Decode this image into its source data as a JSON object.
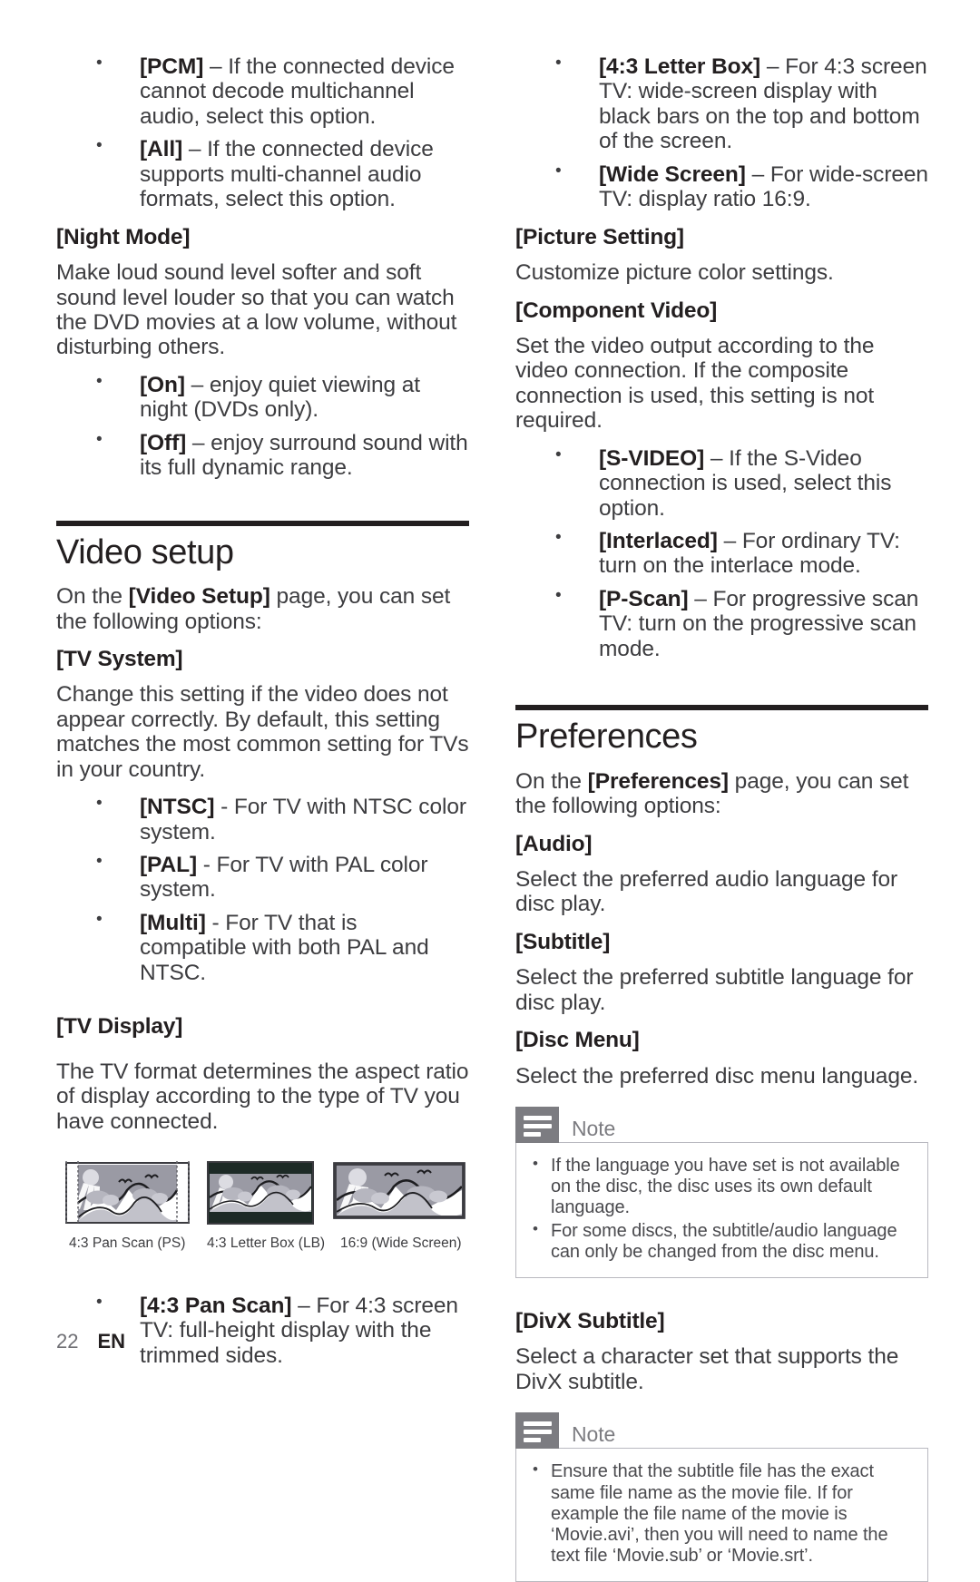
{
  "page": {
    "number": "22",
    "language": "EN"
  },
  "left_column": {
    "audio_bullets": [
      {
        "term": "[PCM]",
        "dash": " – ",
        "text": "If the connected device cannot decode multichannel audio, select this option."
      },
      {
        "term": "[All]",
        "dash": " – ",
        "text": "If the connected device supports multi-channel audio formats, select this option."
      }
    ],
    "night_mode": {
      "heading": "[Night Mode]",
      "paragraph": "Make loud sound level softer and soft sound level louder so that you can watch the DVD movies at a low volume, without disturbing others.",
      "bullets": [
        {
          "term": "[On]",
          "dash": " – ",
          "text": "enjoy quiet viewing at night (DVDs only)."
        },
        {
          "term": "[Off]",
          "dash": " – ",
          "text": "enjoy surround sound with its full dynamic range."
        }
      ]
    },
    "video_setup": {
      "title": "Video setup",
      "intro_pre": "On the ",
      "intro_bold": "[Video Setup]",
      "intro_post": " page, you can set the following options:"
    },
    "tv_system": {
      "heading": "[TV System]",
      "paragraph": "Change this setting if the video does not appear correctly. By default, this setting matches the most common setting for TVs in your country.",
      "bullets": [
        {
          "term": "[NTSC]",
          "dash": " - ",
          "text": "For TV with NTSC color system."
        },
        {
          "term": "[PAL]",
          "dash": " - ",
          "text": "For TV with PAL color system."
        },
        {
          "term": "[Multi]",
          "dash": " - ",
          "text": "For TV that is compatible with both PAL and NTSC."
        }
      ]
    },
    "tv_display": {
      "heading": "[TV Display]",
      "paragraph": "The TV format determines the aspect ratio of display according to the type of TV you have connected.",
      "figure_captions": [
        "4:3 Pan Scan (PS)",
        "4:3 Letter Box (LB)",
        "16:9 (Wide Screen)"
      ],
      "bullets": [
        {
          "term": "[4:3 Pan Scan]",
          "dash": " – ",
          "text": "For 4:3 screen TV: full-height display with the trimmed sides."
        }
      ]
    }
  },
  "right_column": {
    "tv_display_bullets": [
      {
        "term": "[4:3 Letter Box]",
        "dash": " – ",
        "text": "For 4:3 screen TV: wide-screen display with black bars on the top and bottom of the screen."
      },
      {
        "term": "[Wide Screen]",
        "dash": " – ",
        "text": "For wide-screen TV: display ratio 16:9."
      }
    ],
    "picture_setting": {
      "heading": "[Picture Setting]",
      "paragraph": "Customize picture color settings."
    },
    "component_video": {
      "heading": "[Component Video]",
      "paragraph": "Set the video output according to the video connection. If the composite connection is used, this setting is not required.",
      "bullets": [
        {
          "term": "[S-VIDEO]",
          "dash": " – ",
          "text": "If the S-Video connection is used, select this option."
        },
        {
          "term": "[Interlaced]",
          "dash": " – ",
          "text": "For ordinary TV: turn on the interlace mode."
        },
        {
          "term": "[P-Scan]",
          "dash": " – ",
          "text": "For progressive scan TV: turn on the progressive scan mode."
        }
      ]
    },
    "preferences": {
      "title": "Preferences",
      "intro_pre": "On the ",
      "intro_bold": "[Preferences]",
      "intro_post": " page, you can set the following options:"
    },
    "audio": {
      "heading": "[Audio]",
      "paragraph": "Select the preferred audio language for disc play."
    },
    "subtitle": {
      "heading": "[Subtitle]",
      "paragraph": "Select the preferred subtitle language for disc play."
    },
    "disc_menu": {
      "heading": "[Disc Menu]",
      "paragraph": "Select the preferred disc menu language."
    },
    "note_1": {
      "title": "Note",
      "items": [
        "If the language you have set is not available on the disc, the disc uses its own default language.",
        "For some discs, the subtitle/audio language can only be changed from the disc menu."
      ]
    },
    "divx_subtitle": {
      "heading": "[DivX Subtitle]",
      "paragraph": "Select a character set that supports the DivX subtitle."
    },
    "note_2": {
      "title": "Note",
      "items": [
        "Ensure that the subtitle file has the exact same file name as the movie file. If for example the file name of the movie is ‘Movie.avi’, then you will need to name the text file ‘Movie.sub’ or ‘Movie.srt’."
      ]
    }
  },
  "colors": {
    "ink": "#231f20",
    "body_text": "#3d3d40",
    "note_gray": "#7c7c81",
    "note_border": "#b9b9c0"
  }
}
